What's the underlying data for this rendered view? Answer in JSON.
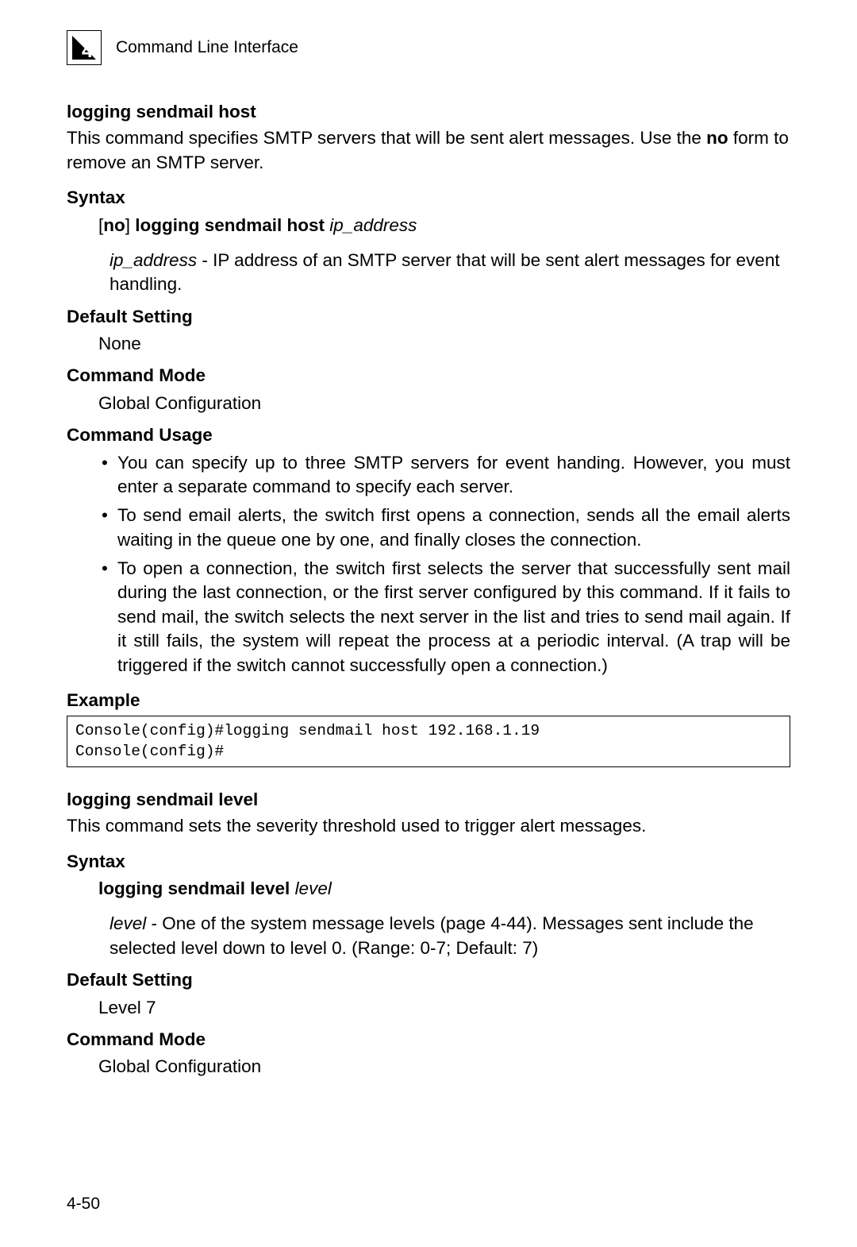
{
  "header": {
    "chapter_glyph": "4",
    "chapter_title": "Command Line Interface"
  },
  "section1": {
    "title": "logging sendmail host",
    "intro_pre": "This command specifies SMTP servers that will be sent alert messages. Use the ",
    "intro_bold": "no",
    "intro_post": " form to remove an SMTP server.",
    "syntax_label": "Syntax",
    "syntax_bracket_open": "[",
    "syntax_no": "no",
    "syntax_bracket_close": "]",
    "syntax_cmd": " logging sendmail host ",
    "syntax_param": "ip_address",
    "param_name": "ip_address",
    "param_sep": " - ",
    "param_desc": "IP address of an SMTP server that will be sent alert messages for event handling.",
    "default_label": "Default Setting",
    "default_value": "None",
    "mode_label": "Command Mode",
    "mode_value": "Global Configuration",
    "usage_label": "Command Usage",
    "usage_items": [
      "You can specify up to three SMTP servers for event handing. However, you must enter a separate command to specify each server.",
      "To send email alerts, the switch first opens a connection, sends all the email alerts waiting in the queue one by one, and finally closes the connection.",
      "To open a connection, the switch first selects the server that successfully sent mail during the last connection, or the first server configured by this command. If it fails to send mail, the switch selects the next server in the list and tries to send mail again. If it still fails, the system will repeat the process at a periodic interval. (A trap will be triggered if the switch cannot successfully open a connection.)"
    ],
    "example_label": "Example",
    "example_code": "Console(config)#logging sendmail host 192.168.1.19\nConsole(config)#"
  },
  "section2": {
    "title": "logging sendmail level",
    "intro": "This command sets the severity threshold used to trigger alert messages.",
    "syntax_label": "Syntax",
    "syntax_cmd": "logging sendmail level ",
    "syntax_param": "level",
    "param_name": "level",
    "param_sep": " - ",
    "param_desc": "One of the system message levels (page 4-44). Messages sent include the selected level down to level 0. (Range: 0-7; Default: 7)",
    "default_label": "Default Setting",
    "default_value": "Level 7",
    "mode_label": "Command Mode",
    "mode_value": "Global Configuration"
  },
  "page_number": "4-50"
}
